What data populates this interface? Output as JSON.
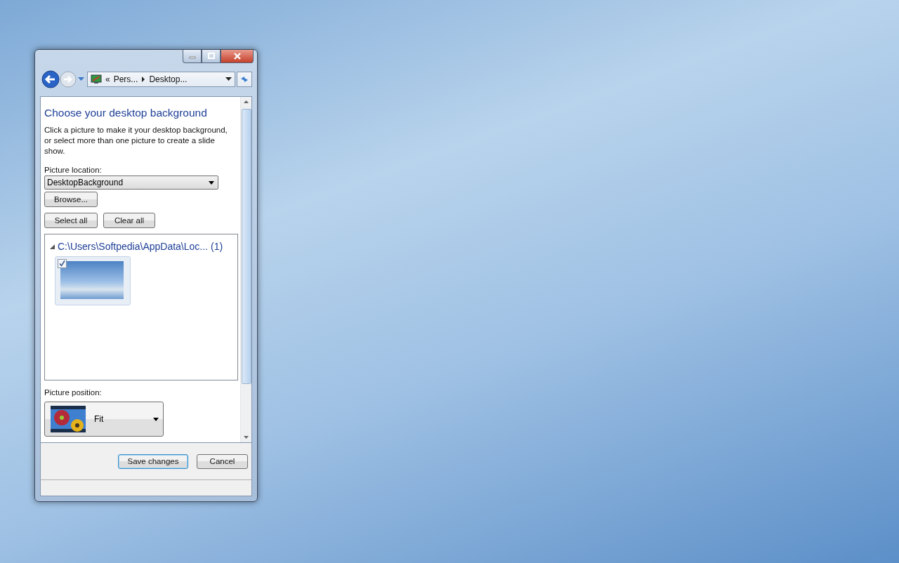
{
  "window": {
    "address": {
      "chevron": "«",
      "crumbs": [
        "Pers...",
        "Desktop..."
      ]
    },
    "heading": "Choose your desktop background",
    "description": "Click a picture to make it your desktop background, or select more than one picture to create a slide show.",
    "location": {
      "label": "Picture location:",
      "value": "DesktopBackground"
    },
    "buttons": [
      "Browse...",
      "Select all",
      "Clear all"
    ],
    "group": {
      "path": "C:\\Users\\Softpedia\\AppData\\Loc...",
      "count": "(1)",
      "expanded": true,
      "pictures": [
        {
          "checked": true
        }
      ]
    },
    "position": {
      "label": "Picture position:",
      "value": "Fit"
    },
    "footer_buttons": [
      {
        "label": "Save changes",
        "default": true
      },
      {
        "label": "Cancel",
        "default": false
      }
    ]
  }
}
